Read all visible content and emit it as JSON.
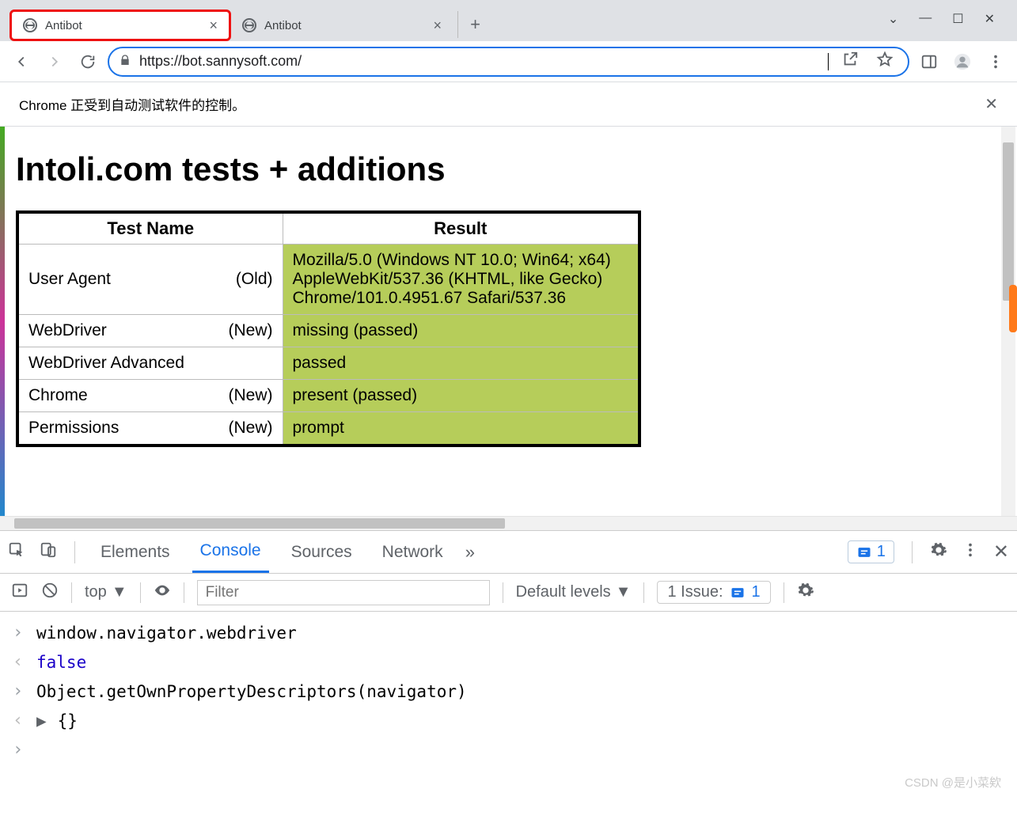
{
  "browser": {
    "tabs": [
      {
        "title": "Antibot",
        "active": true,
        "highlighted": true
      },
      {
        "title": "Antibot",
        "active": false,
        "highlighted": false
      }
    ],
    "url": "https://bot.sannysoft.com/",
    "infobar": "Chrome 正受到自动测试软件的控制。"
  },
  "page": {
    "heading": "Intoli.com tests + additions",
    "table": {
      "headers": [
        "Test Name",
        "Result"
      ],
      "rows": [
        {
          "name": "User Agent",
          "tag": "(Old)",
          "result": "Mozilla/5.0 (Windows NT 10.0; Win64; x64) AppleWebKit/537.36 (KHTML, like Gecko) Chrome/101.0.4951.67 Safari/537.36"
        },
        {
          "name": "WebDriver",
          "tag": "(New)",
          "result": "missing (passed)"
        },
        {
          "name": "WebDriver Advanced",
          "tag": "",
          "result": "passed"
        },
        {
          "name": "Chrome",
          "tag": "(New)",
          "result": "present (passed)"
        },
        {
          "name": "Permissions",
          "tag": "(New)",
          "result": "prompt"
        }
      ]
    }
  },
  "devtools": {
    "tabs": [
      "Elements",
      "Console",
      "Sources",
      "Network"
    ],
    "active_tab": "Console",
    "badge_count": "1",
    "toolbar": {
      "context": "top",
      "filter_placeholder": "Filter",
      "levels": "Default levels",
      "issues_label": "1 Issue:",
      "issues_count": "1"
    },
    "console": [
      {
        "kind": "in",
        "text": "window.navigator.webdriver"
      },
      {
        "kind": "out",
        "text": "false",
        "cls": "val-false"
      },
      {
        "kind": "in",
        "text": "Object.getOwnPropertyDescriptors(navigator)"
      },
      {
        "kind": "out",
        "text": "{}",
        "expand": true
      },
      {
        "kind": "in",
        "text": ""
      }
    ]
  },
  "watermark": "CSDN @是小菜欸"
}
